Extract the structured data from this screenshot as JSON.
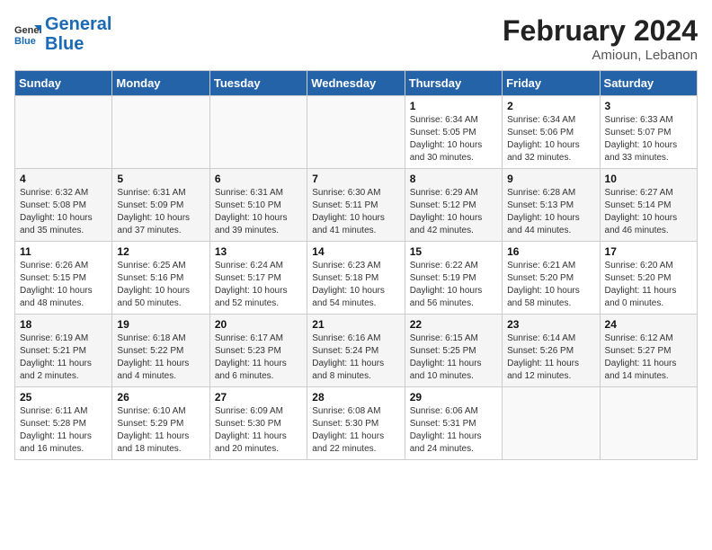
{
  "header": {
    "logo_line1": "General",
    "logo_line2": "Blue",
    "title": "February 2024",
    "subtitle": "Amioun, Lebanon"
  },
  "days_of_week": [
    "Sunday",
    "Monday",
    "Tuesday",
    "Wednesday",
    "Thursday",
    "Friday",
    "Saturday"
  ],
  "weeks": [
    [
      {
        "num": "",
        "info": ""
      },
      {
        "num": "",
        "info": ""
      },
      {
        "num": "",
        "info": ""
      },
      {
        "num": "",
        "info": ""
      },
      {
        "num": "1",
        "info": "Sunrise: 6:34 AM\nSunset: 5:05 PM\nDaylight: 10 hours\nand 30 minutes."
      },
      {
        "num": "2",
        "info": "Sunrise: 6:34 AM\nSunset: 5:06 PM\nDaylight: 10 hours\nand 32 minutes."
      },
      {
        "num": "3",
        "info": "Sunrise: 6:33 AM\nSunset: 5:07 PM\nDaylight: 10 hours\nand 33 minutes."
      }
    ],
    [
      {
        "num": "4",
        "info": "Sunrise: 6:32 AM\nSunset: 5:08 PM\nDaylight: 10 hours\nand 35 minutes."
      },
      {
        "num": "5",
        "info": "Sunrise: 6:31 AM\nSunset: 5:09 PM\nDaylight: 10 hours\nand 37 minutes."
      },
      {
        "num": "6",
        "info": "Sunrise: 6:31 AM\nSunset: 5:10 PM\nDaylight: 10 hours\nand 39 minutes."
      },
      {
        "num": "7",
        "info": "Sunrise: 6:30 AM\nSunset: 5:11 PM\nDaylight: 10 hours\nand 41 minutes."
      },
      {
        "num": "8",
        "info": "Sunrise: 6:29 AM\nSunset: 5:12 PM\nDaylight: 10 hours\nand 42 minutes."
      },
      {
        "num": "9",
        "info": "Sunrise: 6:28 AM\nSunset: 5:13 PM\nDaylight: 10 hours\nand 44 minutes."
      },
      {
        "num": "10",
        "info": "Sunrise: 6:27 AM\nSunset: 5:14 PM\nDaylight: 10 hours\nand 46 minutes."
      }
    ],
    [
      {
        "num": "11",
        "info": "Sunrise: 6:26 AM\nSunset: 5:15 PM\nDaylight: 10 hours\nand 48 minutes."
      },
      {
        "num": "12",
        "info": "Sunrise: 6:25 AM\nSunset: 5:16 PM\nDaylight: 10 hours\nand 50 minutes."
      },
      {
        "num": "13",
        "info": "Sunrise: 6:24 AM\nSunset: 5:17 PM\nDaylight: 10 hours\nand 52 minutes."
      },
      {
        "num": "14",
        "info": "Sunrise: 6:23 AM\nSunset: 5:18 PM\nDaylight: 10 hours\nand 54 minutes."
      },
      {
        "num": "15",
        "info": "Sunrise: 6:22 AM\nSunset: 5:19 PM\nDaylight: 10 hours\nand 56 minutes."
      },
      {
        "num": "16",
        "info": "Sunrise: 6:21 AM\nSunset: 5:20 PM\nDaylight: 10 hours\nand 58 minutes."
      },
      {
        "num": "17",
        "info": "Sunrise: 6:20 AM\nSunset: 5:20 PM\nDaylight: 11 hours\nand 0 minutes."
      }
    ],
    [
      {
        "num": "18",
        "info": "Sunrise: 6:19 AM\nSunset: 5:21 PM\nDaylight: 11 hours\nand 2 minutes."
      },
      {
        "num": "19",
        "info": "Sunrise: 6:18 AM\nSunset: 5:22 PM\nDaylight: 11 hours\nand 4 minutes."
      },
      {
        "num": "20",
        "info": "Sunrise: 6:17 AM\nSunset: 5:23 PM\nDaylight: 11 hours\nand 6 minutes."
      },
      {
        "num": "21",
        "info": "Sunrise: 6:16 AM\nSunset: 5:24 PM\nDaylight: 11 hours\nand 8 minutes."
      },
      {
        "num": "22",
        "info": "Sunrise: 6:15 AM\nSunset: 5:25 PM\nDaylight: 11 hours\nand 10 minutes."
      },
      {
        "num": "23",
        "info": "Sunrise: 6:14 AM\nSunset: 5:26 PM\nDaylight: 11 hours\nand 12 minutes."
      },
      {
        "num": "24",
        "info": "Sunrise: 6:12 AM\nSunset: 5:27 PM\nDaylight: 11 hours\nand 14 minutes."
      }
    ],
    [
      {
        "num": "25",
        "info": "Sunrise: 6:11 AM\nSunset: 5:28 PM\nDaylight: 11 hours\nand 16 minutes."
      },
      {
        "num": "26",
        "info": "Sunrise: 6:10 AM\nSunset: 5:29 PM\nDaylight: 11 hours\nand 18 minutes."
      },
      {
        "num": "27",
        "info": "Sunrise: 6:09 AM\nSunset: 5:30 PM\nDaylight: 11 hours\nand 20 minutes."
      },
      {
        "num": "28",
        "info": "Sunrise: 6:08 AM\nSunset: 5:30 PM\nDaylight: 11 hours\nand 22 minutes."
      },
      {
        "num": "29",
        "info": "Sunrise: 6:06 AM\nSunset: 5:31 PM\nDaylight: 11 hours\nand 24 minutes."
      },
      {
        "num": "",
        "info": ""
      },
      {
        "num": "",
        "info": ""
      }
    ]
  ]
}
